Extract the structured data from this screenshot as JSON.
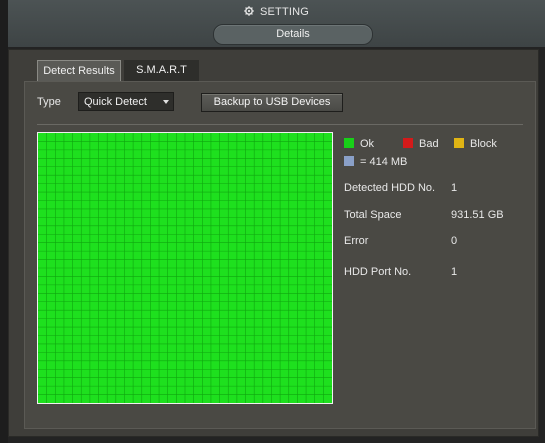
{
  "header": {
    "title": "SETTING",
    "subtitle": "Details"
  },
  "tabs": [
    {
      "label": "Detect Results",
      "active": true
    },
    {
      "label": "S.M.A.R.T",
      "active": false
    }
  ],
  "controls": {
    "type_label": "Type",
    "type_selected": "Quick Detect",
    "backup_label": "Backup to USB Devices"
  },
  "legend": {
    "ok_label": "Ok",
    "bad_label": "Bad",
    "block_label": "Block",
    "unit_label": "= 414 MB",
    "colors": {
      "ok": "#18d018",
      "bad": "#d41a1a",
      "block": "#e0b414",
      "unit": "#8aa0c8"
    }
  },
  "info": [
    {
      "label": "Detected HDD No.",
      "value": "1"
    },
    {
      "label": "Total Space",
      "value": "931.51 GB"
    },
    {
      "label": "Error",
      "value": "0"
    },
    {
      "label": "HDD Port No.",
      "value": "1"
    }
  ],
  "colors": {
    "grid_fill": "#1ee01e",
    "grid_line": "#0fa60f"
  }
}
